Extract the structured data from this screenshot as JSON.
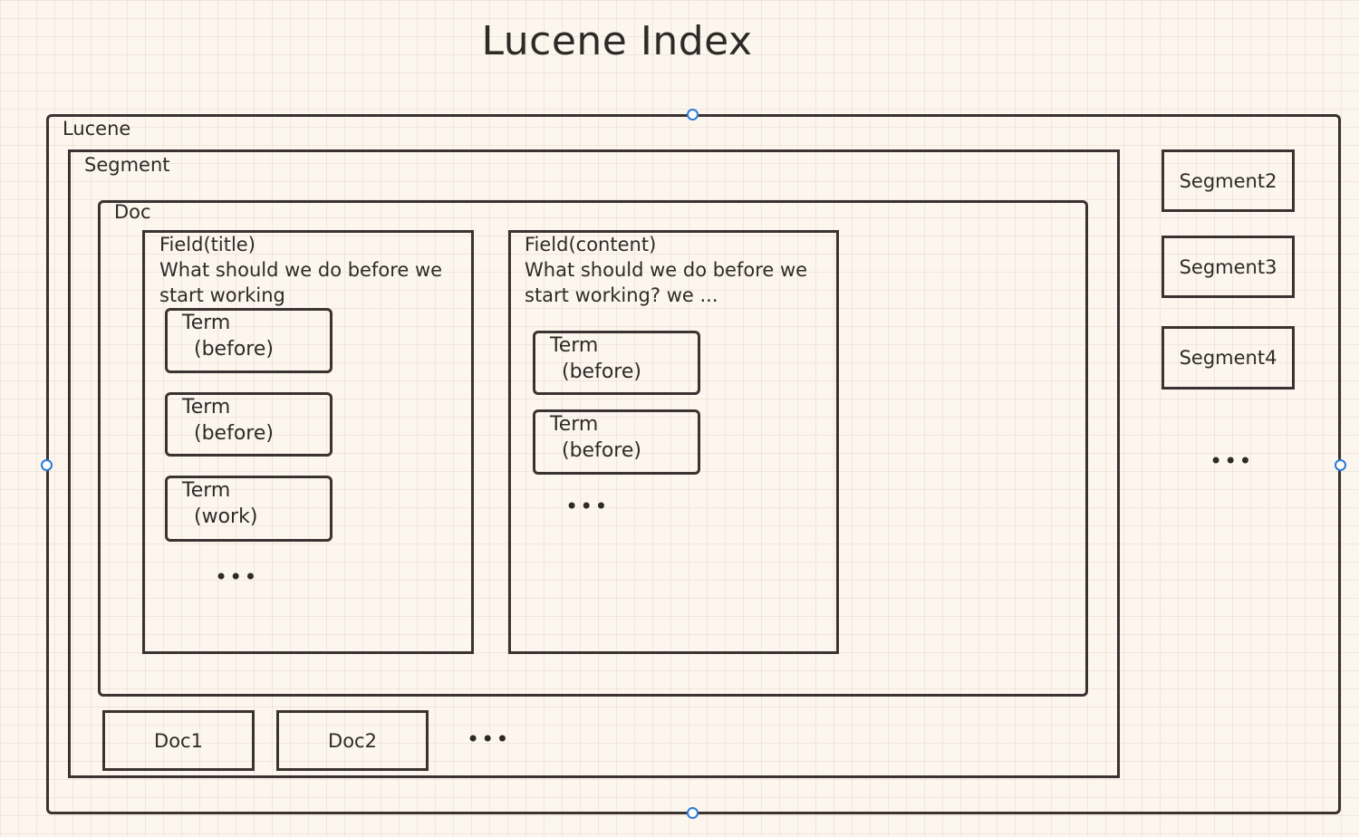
{
  "title": "Lucene Index",
  "lucene": {
    "label": "Lucene"
  },
  "segment": {
    "label": "Segment"
  },
  "doc": {
    "label": "Doc"
  },
  "field_title": {
    "label": "Field(title)",
    "text": "What should we do before we\nstart working",
    "terms": [
      {
        "label": "Term",
        "value": "(before)"
      },
      {
        "label": "Term",
        "value": "(before)"
      },
      {
        "label": "Term",
        "value": "(work)"
      }
    ],
    "more": "•••"
  },
  "field_content": {
    "label": "Field(content)",
    "text": "What should we do before we\nstart working? we ...",
    "terms": [
      {
        "label": "Term",
        "value": "(before)"
      },
      {
        "label": "Term",
        "value": "(before)"
      }
    ],
    "more": "•••"
  },
  "docs": [
    "Doc1",
    "Doc2"
  ],
  "docs_more": "•••",
  "segments": [
    "Segment2",
    "Segment3",
    "Segment4"
  ],
  "segments_more": "•••",
  "colors": {
    "background": "#fdf6ef",
    "border": "#3b3331",
    "selection_handle": "#2b79d6"
  }
}
